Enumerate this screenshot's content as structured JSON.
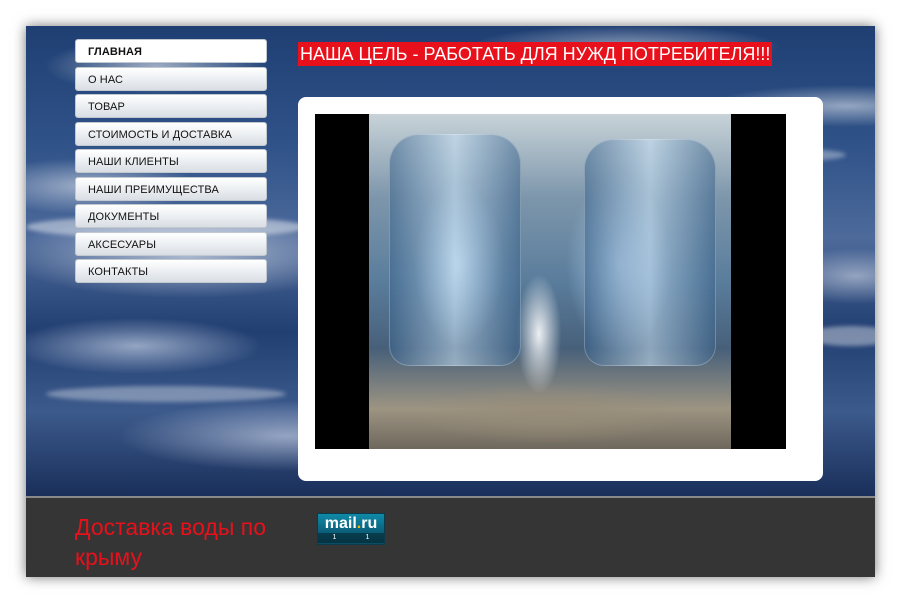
{
  "nav": {
    "items": [
      {
        "label": "ГЛАВНАЯ",
        "active": true
      },
      {
        "label": "О НАС",
        "active": false
      },
      {
        "label": "ТОВАР",
        "active": false
      },
      {
        "label": "СТОИМОСТЬ И ДОСТАВКА",
        "active": false
      },
      {
        "label": "НАШИ КЛИЕНТЫ",
        "active": false
      },
      {
        "label": "НАШИ ПРЕИМУЩЕСТВА",
        "active": false
      },
      {
        "label": "ДОКУМЕНТЫ",
        "active": false
      },
      {
        "label": "АКСЕСУАРЫ",
        "active": false
      },
      {
        "label": "КОНТАКТЫ",
        "active": false
      }
    ]
  },
  "header": {
    "slogan": "НАША ЦЕЛЬ - РАБОТАТЬ ДЛЯ НУЖД  ПОТРЕБИТЕЛЯ!!!"
  },
  "footer": {
    "text": "Доставка воды по крыму",
    "counter": {
      "logo_main": "mail",
      "logo_dot": ".",
      "logo_tld": "ru",
      "value_left": "1",
      "value_right": "1"
    }
  },
  "colors": {
    "accent_red": "#e8101a",
    "footer_bg": "#353535",
    "water_blue": "#2f5288"
  }
}
